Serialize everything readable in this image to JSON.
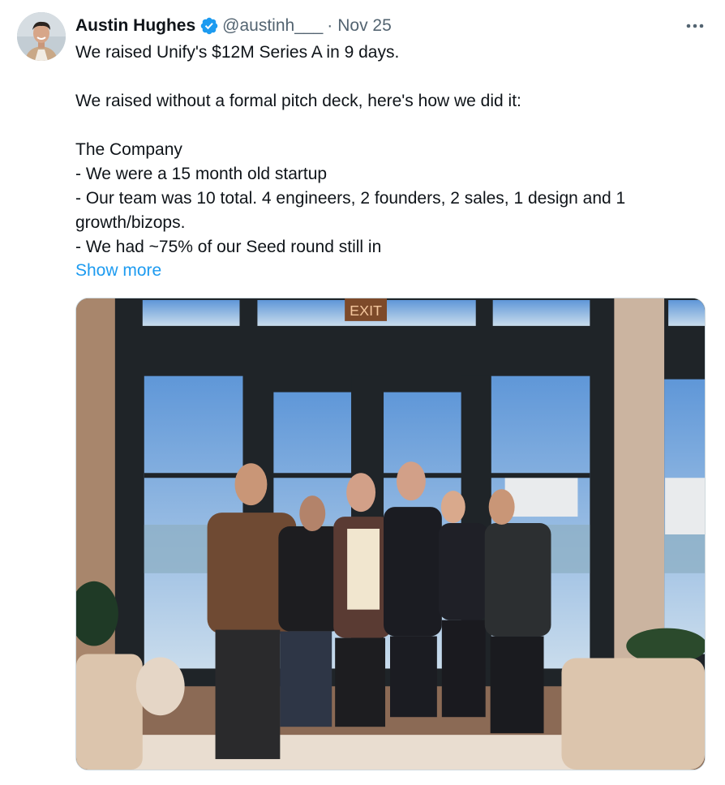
{
  "author": {
    "name": "Austin Hughes",
    "handle": "@austinh___",
    "separator": "·",
    "date": "Nov 25"
  },
  "icons": {
    "avatar": "profile-photo",
    "verified": "verified-badge-icon",
    "more": "more-options-icon"
  },
  "tweet": {
    "lines": [
      "We raised Unify's $12M Series A in 9 days.",
      "",
      "We raised without a formal pitch deck, here's how we did it:",
      "",
      "The Company",
      "- We were a 15 month old startup",
      "- Our team was 10 total. 4 engineers, 2 founders, 2 sales, 1 design and 1",
      "growth/bizops.",
      "- We had ~75% of our Seed round still in"
    ],
    "show_more": "Show more"
  },
  "media": {
    "exit_sign": "EXIT"
  },
  "colors": {
    "text": "#0f1419",
    "secondary": "#536471",
    "link": "#1d9bf0",
    "verified": "#1d9bf0"
  }
}
